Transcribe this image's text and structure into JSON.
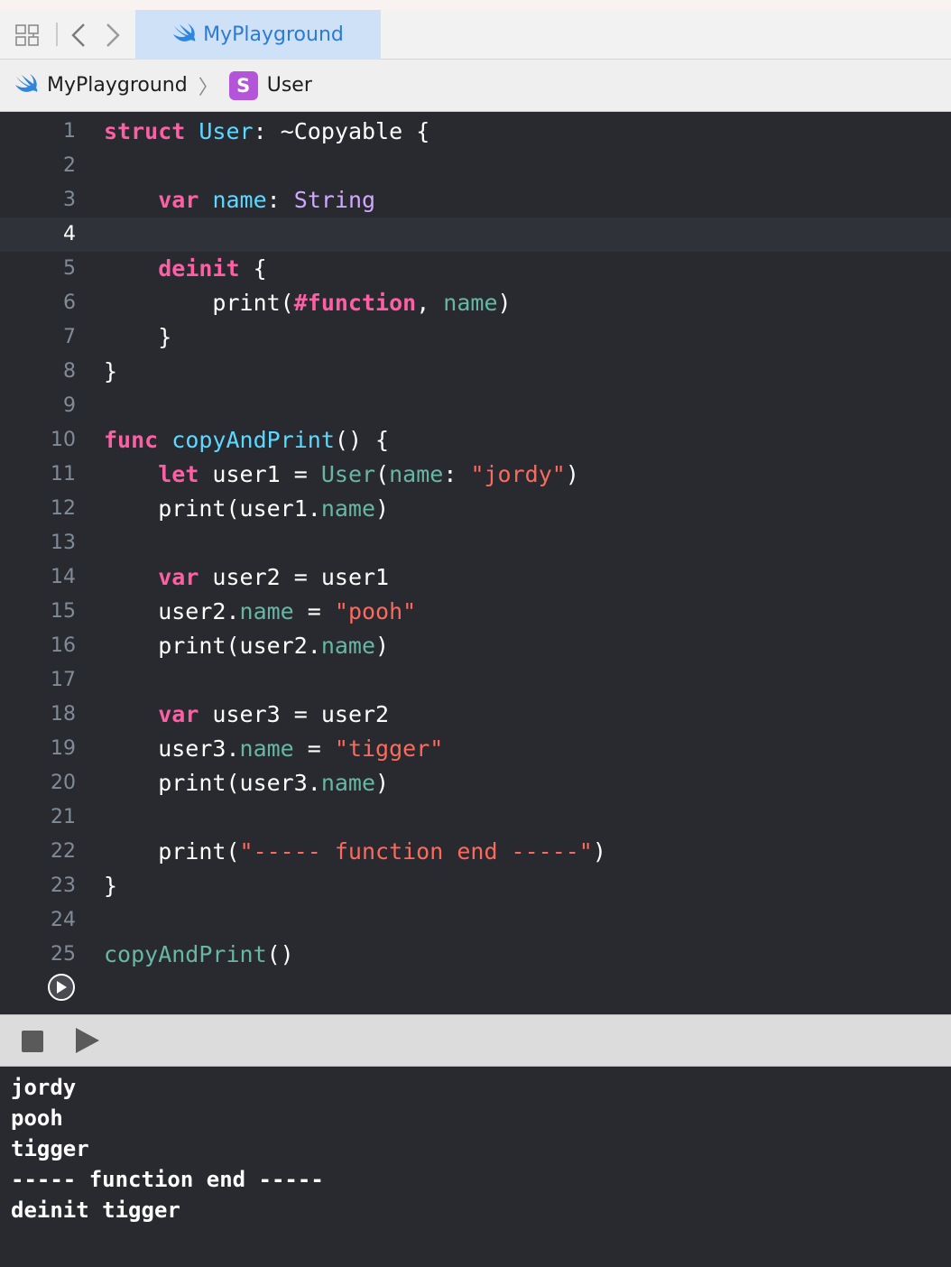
{
  "tabbar": {
    "active_tab": "MyPlayground"
  },
  "breadcrumb": {
    "project": "MyPlayground",
    "badge": "S",
    "symbol": "User"
  },
  "editor": {
    "current_line": 4,
    "lines": [
      {
        "n": "1",
        "tokens": [
          {
            "t": "struct",
            "c": "kw"
          },
          {
            "t": " "
          },
          {
            "t": "User",
            "c": "ty"
          },
          {
            "t": ": ~Copyable {"
          }
        ]
      },
      {
        "n": "2",
        "tokens": []
      },
      {
        "n": "3",
        "tokens": [
          {
            "t": "    "
          },
          {
            "t": "var",
            "c": "kw"
          },
          {
            "t": " "
          },
          {
            "t": "name",
            "c": "ty"
          },
          {
            "t": ": "
          },
          {
            "t": "String",
            "c": "tn"
          }
        ]
      },
      {
        "n": "4",
        "tokens": []
      },
      {
        "n": "5",
        "tokens": [
          {
            "t": "    "
          },
          {
            "t": "deinit",
            "c": "kw"
          },
          {
            "t": " {"
          }
        ]
      },
      {
        "n": "6",
        "tokens": [
          {
            "t": "        print("
          },
          {
            "t": "#function",
            "c": "kw"
          },
          {
            "t": ", "
          },
          {
            "t": "name",
            "c": "pr"
          },
          {
            "t": ")"
          }
        ]
      },
      {
        "n": "7",
        "tokens": [
          {
            "t": "    }"
          }
        ]
      },
      {
        "n": "8",
        "tokens": [
          {
            "t": "}"
          }
        ]
      },
      {
        "n": "9",
        "tokens": []
      },
      {
        "n": "10",
        "tokens": [
          {
            "t": "func",
            "c": "kw"
          },
          {
            "t": " "
          },
          {
            "t": "copyAndPrint",
            "c": "ty"
          },
          {
            "t": "() {"
          }
        ]
      },
      {
        "n": "11",
        "tokens": [
          {
            "t": "    "
          },
          {
            "t": "let",
            "c": "kw"
          },
          {
            "t": " user1 = "
          },
          {
            "t": "User",
            "c": "fn"
          },
          {
            "t": "("
          },
          {
            "t": "name",
            "c": "pr"
          },
          {
            "t": ": "
          },
          {
            "t": "\"jordy\"",
            "c": "st"
          },
          {
            "t": ")"
          }
        ]
      },
      {
        "n": "12",
        "tokens": [
          {
            "t": "    print(user1."
          },
          {
            "t": "name",
            "c": "pr"
          },
          {
            "t": ")"
          }
        ]
      },
      {
        "n": "13",
        "tokens": []
      },
      {
        "n": "14",
        "tokens": [
          {
            "t": "    "
          },
          {
            "t": "var",
            "c": "kw"
          },
          {
            "t": " user2 = user1"
          }
        ]
      },
      {
        "n": "15",
        "tokens": [
          {
            "t": "    user2."
          },
          {
            "t": "name",
            "c": "pr"
          },
          {
            "t": " = "
          },
          {
            "t": "\"pooh\"",
            "c": "st"
          }
        ]
      },
      {
        "n": "16",
        "tokens": [
          {
            "t": "    print(user2."
          },
          {
            "t": "name",
            "c": "pr"
          },
          {
            "t": ")"
          }
        ]
      },
      {
        "n": "17",
        "tokens": []
      },
      {
        "n": "18",
        "tokens": [
          {
            "t": "    "
          },
          {
            "t": "var",
            "c": "kw"
          },
          {
            "t": " user3 = user2"
          }
        ]
      },
      {
        "n": "19",
        "tokens": [
          {
            "t": "    user3."
          },
          {
            "t": "name",
            "c": "pr"
          },
          {
            "t": " = "
          },
          {
            "t": "\"tigger\"",
            "c": "st"
          }
        ]
      },
      {
        "n": "20",
        "tokens": [
          {
            "t": "    print(user3."
          },
          {
            "t": "name",
            "c": "pr"
          },
          {
            "t": ")"
          }
        ]
      },
      {
        "n": "21",
        "tokens": []
      },
      {
        "n": "22",
        "tokens": [
          {
            "t": "    print("
          },
          {
            "t": "\"----- function end -----\"",
            "c": "st"
          },
          {
            "t": ")"
          }
        ]
      },
      {
        "n": "23",
        "tokens": [
          {
            "t": "}"
          }
        ]
      },
      {
        "n": "24",
        "tokens": []
      },
      {
        "n": "25",
        "tokens": [
          {
            "t": "copyAndPrint",
            "c": "fn"
          },
          {
            "t": "()"
          }
        ]
      }
    ]
  },
  "console": {
    "output": [
      "jordy",
      "pooh",
      "tigger",
      "----- function end -----",
      "deinit tigger"
    ]
  },
  "colors": {
    "keyword": "#fc5fa3",
    "type_decl": "#5dd8ff",
    "property": "#67b7a4",
    "string": "#fc6a5d",
    "type_name": "#d0a8ff",
    "background": "#292a30"
  },
  "icons": [
    "grid-icon",
    "back-chevron-icon",
    "forward-chevron-icon",
    "swift-icon",
    "run-icon",
    "stop-icon",
    "play-icon"
  ]
}
